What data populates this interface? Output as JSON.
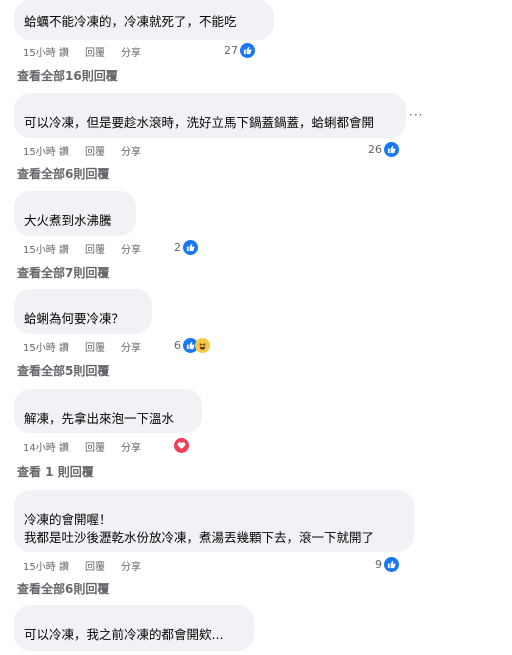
{
  "comments": [
    {
      "text": [
        "蛤蠣不能冷凍的，冷凍就死了，不能吃"
      ],
      "time": "15小時",
      "like": "讚",
      "reply": "回覆",
      "share": "分享",
      "reactions": "27",
      "view_replies": "查看全部16則回覆"
    },
    {
      "text": [
        "可以冷凍，但是要趁水滾時，洗好立馬下鍋蓋鍋蓋，蛤蜊都會開"
      ],
      "time": "15小時",
      "like": "讚",
      "reply": "回覆",
      "share": "分享",
      "reactions": "26",
      "view_replies": "查看全部6則回覆",
      "more": "···"
    },
    {
      "text": [
        "大火煮到水沸騰"
      ],
      "time": "15小時",
      "like": "讚",
      "reply": "回覆",
      "share": "分享",
      "reactions": "2",
      "view_replies": "查看全部7則回覆"
    },
    {
      "text": [
        "蛤蜊為何要冷凍？"
      ],
      "time": "15小時",
      "like": "讚",
      "reply": "回覆",
      "share": "分享",
      "reactions": "6",
      "view_replies": "查看全部5則回覆"
    },
    {
      "text": [
        "解凍，先拿出來泡一下溫水"
      ],
      "time": "14小時",
      "like": "讚",
      "reply": "回覆",
      "share": "分享",
      "reactions": "",
      "view_replies": "查看 1 則回覆"
    },
    {
      "text": [
        "冷凍的會開喔！",
        "我都是吐沙後瀝乾水份放冷凍，煮湯丟幾顆下去，滾一下就開了"
      ],
      "time": "15小時",
      "like": "讚",
      "reply": "回覆",
      "share": "分享",
      "reactions": "9",
      "view_replies": "查看全部6則回覆"
    },
    {
      "text": [
        "可以冷凍，我之前冷凍的都會開欸..."
      ]
    }
  ],
  "colors": {
    "bubble": "#f0f2f5",
    "meta": "#65676b",
    "like": "#1877f2",
    "love": "#f33e58",
    "haha": "#f7c844"
  },
  "icons": {
    "like": "thumbs-up-icon",
    "haha": "haha-icon",
    "love": "heart-icon"
  }
}
